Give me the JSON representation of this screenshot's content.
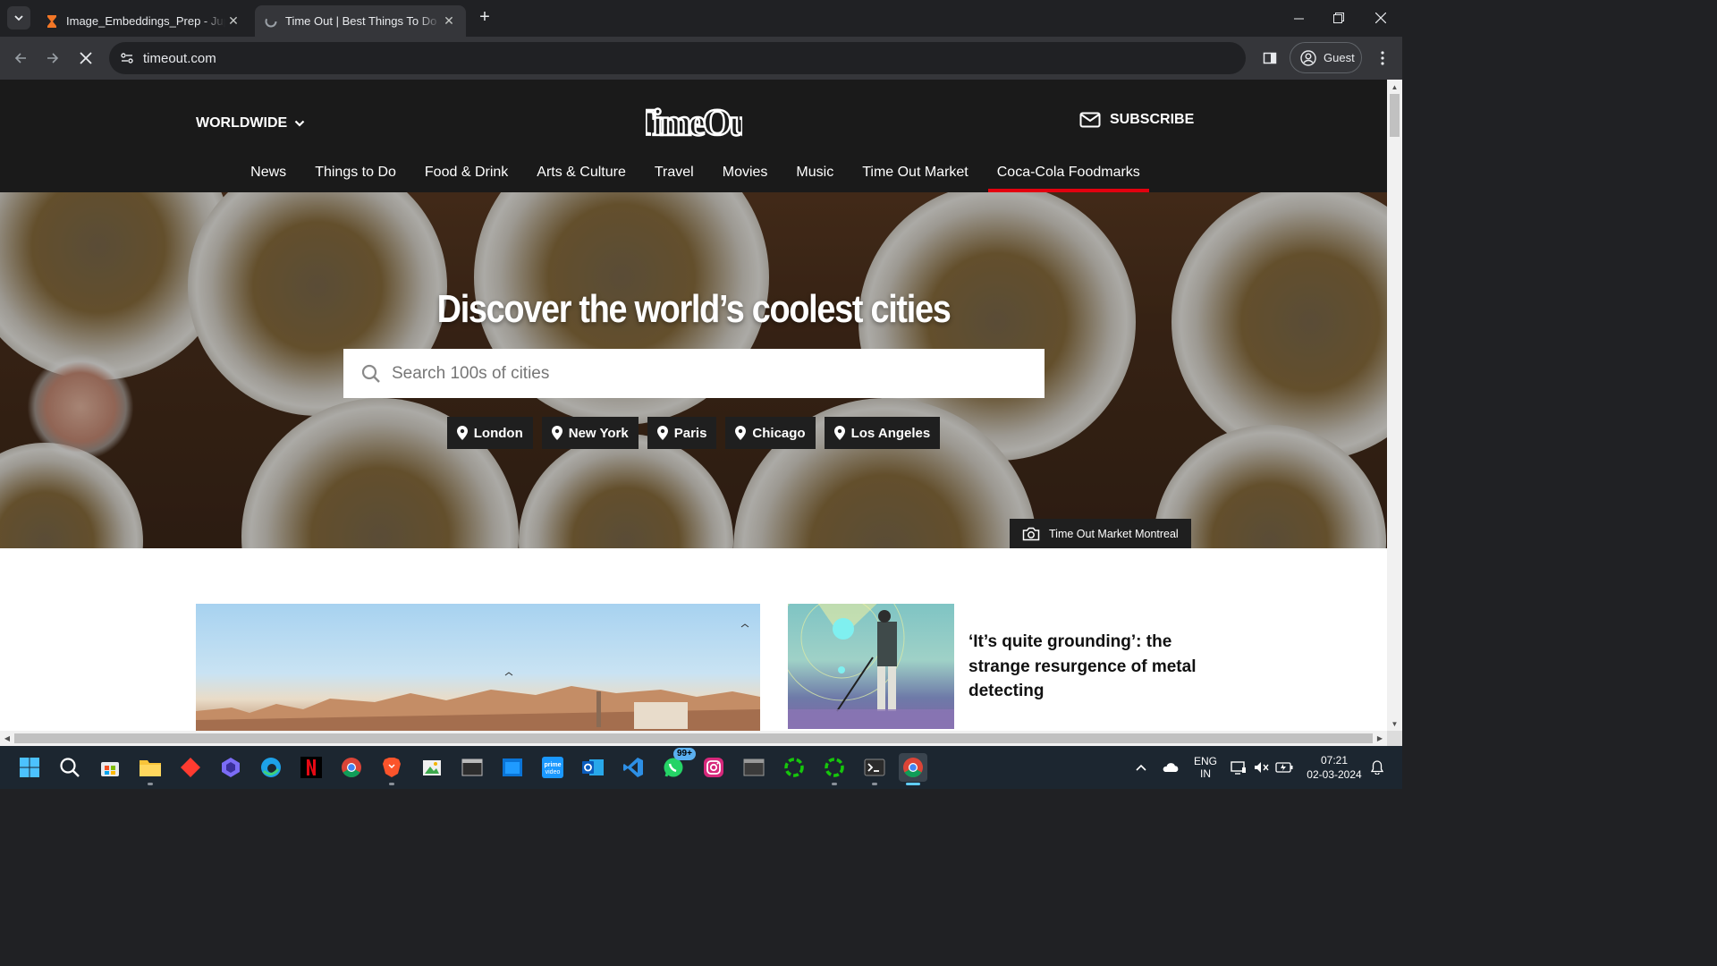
{
  "browser": {
    "tabs": [
      {
        "title": "Image_Embeddings_Prep - Jupyter",
        "active": false
      },
      {
        "title": "Time Out | Best Things To Do and",
        "active": true
      }
    ],
    "url": "timeout.com",
    "profile_label": "Guest"
  },
  "site": {
    "edition": "WORLDWIDE",
    "logo_text": "TimeOut",
    "subscribe_label": "SUBSCRIBE",
    "nav": [
      "News",
      "Things to Do",
      "Food & Drink",
      "Arts & Culture",
      "Travel",
      "Movies",
      "Music",
      "Time Out Market",
      "Coca-Cola Foodmarks"
    ],
    "hero": {
      "title": "Discover the world’s coolest cities",
      "search_placeholder": "Search 100s of cities",
      "cities": [
        "London",
        "New York",
        "Paris",
        "Chicago",
        "Los Angeles"
      ],
      "photo_credit": "Time Out Market Montreal"
    },
    "side_story": {
      "headline": "‘It’s quite grounding’: the strange resurgence of metal detecting"
    }
  },
  "taskbar": {
    "whatsapp_badge": "99+",
    "language": "ENG",
    "region": "IN",
    "time": "07:21",
    "date": "02-03-2024"
  }
}
